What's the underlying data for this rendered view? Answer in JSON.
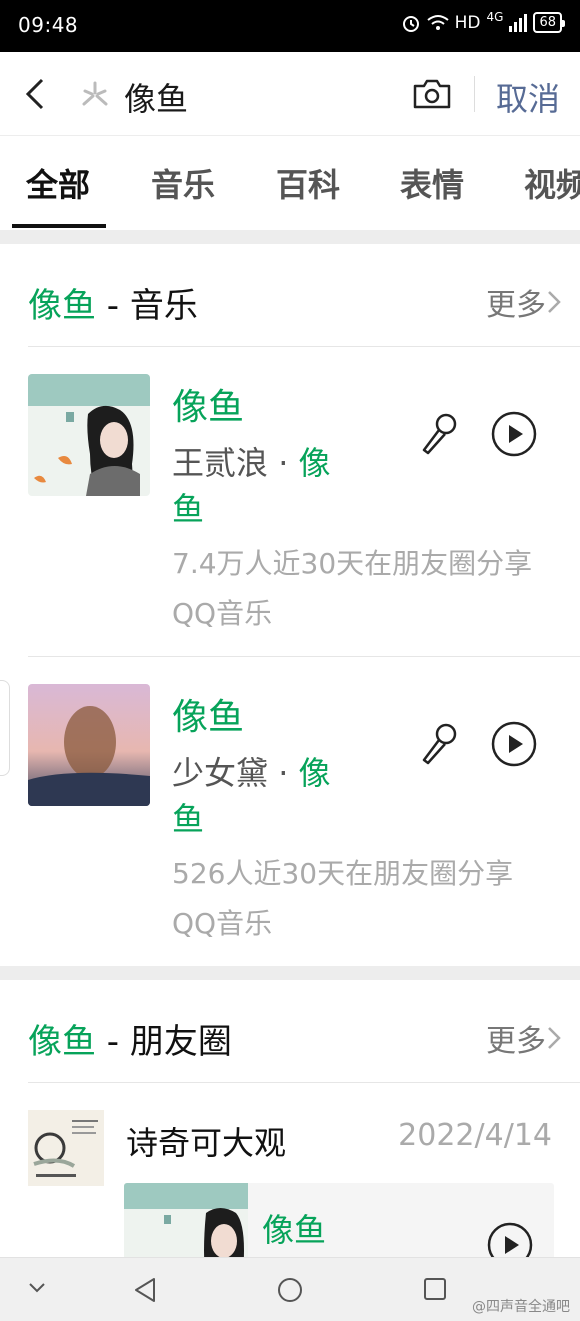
{
  "status_bar": {
    "time": "09:48",
    "network": "HD",
    "signal": "4G",
    "battery": "68"
  },
  "search": {
    "query": "像鱼",
    "cancel_label": "取消"
  },
  "tabs": [
    {
      "label": "全部",
      "active": true
    },
    {
      "label": "音乐",
      "active": false
    },
    {
      "label": "百科",
      "active": false
    },
    {
      "label": "表情",
      "active": false
    },
    {
      "label": "视频",
      "active": false
    }
  ],
  "music_section": {
    "title_highlight": "像鱼",
    "title_rest": " - 音乐",
    "more_label": "更多",
    "songs": [
      {
        "title": "像鱼",
        "artist": "王贰浪",
        "separator": " · ",
        "album": "像鱼",
        "stat": "7.4万人近30天在朋友圈分享",
        "source": "QQ音乐"
      },
      {
        "title": "像鱼",
        "artist": "少女黛",
        "separator": " · ",
        "album": "像鱼",
        "stat": "526人近30天在朋友圈分享",
        "source": "QQ音乐"
      }
    ]
  },
  "moments_section": {
    "title_highlight": "像鱼",
    "title_rest": " - 朋友圈",
    "more_label": "更多",
    "post": {
      "poster": "诗奇可大观",
      "date": "2022/4/14",
      "shared_song_title": "像鱼"
    }
  },
  "watermark": "@四声音全通吧",
  "colors": {
    "accent_green": "#07a35a",
    "link_blue": "#576b95",
    "separator_gray": "#ededed"
  }
}
